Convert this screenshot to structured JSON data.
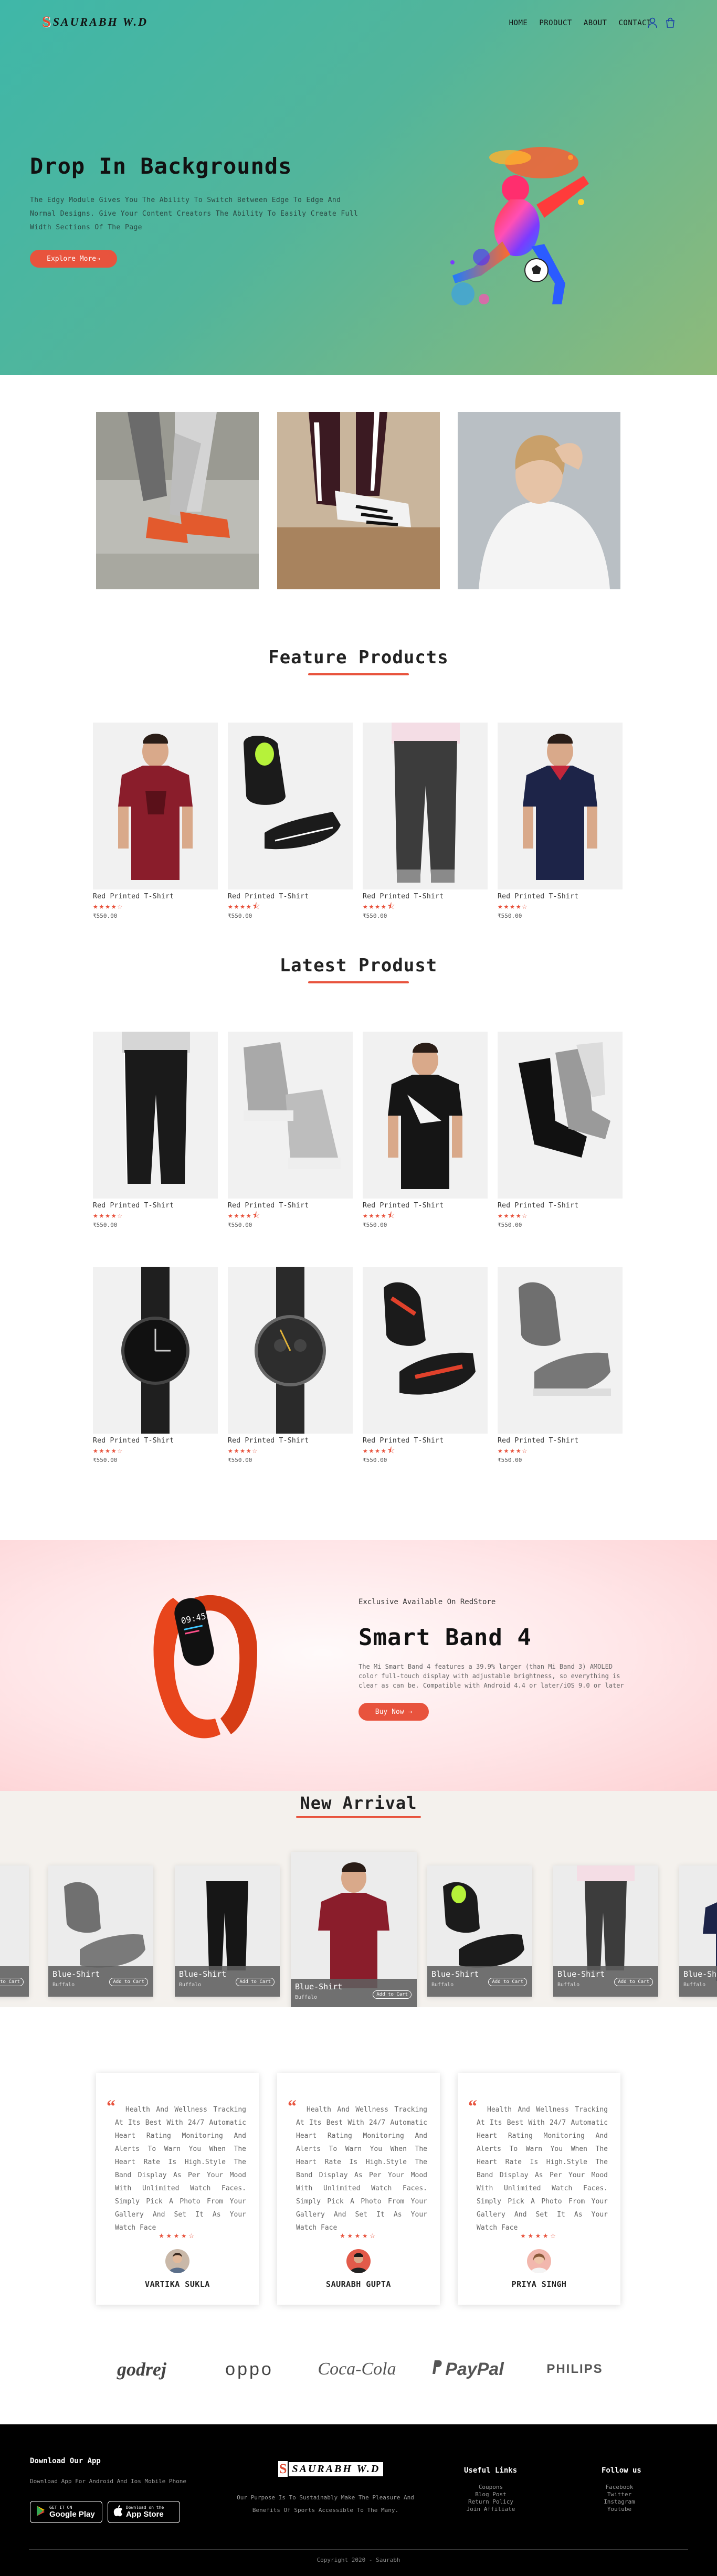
{
  "nav": {
    "logo_letter": "S",
    "logo_text": "SAURABH W.D",
    "links": [
      "HOME",
      "PRODUCT",
      "ABOUT",
      "CONTACT"
    ]
  },
  "hero": {
    "title": "Drop In Backgrounds",
    "description": "The Edgy Module Gives You The Ability To Switch Between Edge To Edge And Normal Designs. Give Your Content Creators The Ability To Easily Create Full Width Sections Of The Page",
    "button": "Explore More→"
  },
  "featured": {
    "title": "Feature Products",
    "products": [
      {
        "name": "Red Printed T-Shirt",
        "stars": "★★★★☆",
        "price": "₹550.00"
      },
      {
        "name": "Red Printed T-Shirt",
        "stars": "★★★★⯪",
        "price": "₹550.00"
      },
      {
        "name": "Red Printed T-Shirt",
        "stars": "★★★★⯪",
        "price": "₹550.00"
      },
      {
        "name": "Red Printed T-Shirt",
        "stars": "★★★★☆",
        "price": "₹550.00"
      }
    ]
  },
  "latest": {
    "title": "Latest Produst",
    "products": [
      {
        "name": "Red Printed T-Shirt",
        "stars": "★★★★☆",
        "price": "₹550.00"
      },
      {
        "name": "Red Printed T-Shirt",
        "stars": "★★★★⯪",
        "price": "₹550.00"
      },
      {
        "name": "Red Printed T-Shirt",
        "stars": "★★★★⯪",
        "price": "₹550.00"
      },
      {
        "name": "Red Printed T-Shirt",
        "stars": "★★★★☆",
        "price": "₹550.00"
      },
      {
        "name": "Red Printed T-Shirt",
        "stars": "★★★★☆",
        "price": "₹550.00"
      },
      {
        "name": "Red Printed T-Shirt",
        "stars": "★★★★☆",
        "price": "₹550.00"
      },
      {
        "name": "Red Printed T-Shirt",
        "stars": "★★★★⯪",
        "price": "₹550.00"
      },
      {
        "name": "Red Printed T-Shirt",
        "stars": "★★★★☆",
        "price": "₹550.00"
      }
    ]
  },
  "band": {
    "kicker": "Exclusive Available On RedStore",
    "title": "Smart Band 4",
    "description": "The Mi Smart Band 4 features a 39.9% larger (than Mi Band 3) AMOLED color full-touch display with adjustable brightness, so everything is clear as can be. Compatible with Android 4.4 or later/iOS 9.0 or later",
    "button": "Buy Now →",
    "watch_time": "09:45"
  },
  "arrival": {
    "title": "New Arrival",
    "card_name": "Blue-Shirt",
    "card_sub": "Buffalo",
    "cart_label": "Add to Cart"
  },
  "testimonials": [
    {
      "text": "Health And Wellness Tracking At Its Best With 24/7 Automatic Heart Rating Monitoring And Alerts To Warn You When The Heart Rate Is High.Style The Band Display As Per Your Mood With Unlimited Watch Faces. Simply Pick A Photo From Your Gallery And Set It As Your Watch Face",
      "stars": "★★★★☆",
      "name": "VARTIKA SUKLA"
    },
    {
      "text": "Health And Wellness Tracking At Its Best With 24/7 Automatic Heart Rating Monitoring And Alerts To Warn You When The Heart Rate Is High.Style The Band Display As Per Your Mood With Unlimited Watch Faces. Simply Pick A Photo From Your Gallery And Set It As Your Watch Face",
      "stars": "★★★★☆",
      "name": "SAURABH GUPTA"
    },
    {
      "text": "Health And Wellness Tracking At Its Best With 24/7 Automatic Heart Rating Monitoring And Alerts To Warn You When The Heart Rate Is High.Style The Band Display As Per Your Mood With Unlimited Watch Faces. Simply Pick A Photo From Your Gallery And Set It As Your Watch Face",
      "stars": "★★★★☆",
      "name": "PRIYA SINGH"
    }
  ],
  "brands": [
    "godrej",
    "oppo",
    "Coca-Cola",
    "PayPal",
    "PHILIPS"
  ],
  "footer": {
    "download_title": "Download Our App",
    "download_text": "Download App For Android And Ios Mobile Phone",
    "google_small": "GET IT ON",
    "google_big": "Google Play",
    "apple_small": "Download on the",
    "apple_big": "App Store",
    "logo_letter": "S",
    "logo_text": "SAURABH W.D",
    "mission": "Our Purpose Is To Sustainably Make The Pleasure And Benefits Of Sports Accessible To The Many.",
    "useful_title": "Useful Links",
    "useful": [
      "Coupons",
      "Blog Post",
      "Return Policy",
      "Join Affiliate"
    ],
    "follow_title": "Follow us",
    "follow": [
      "Facebook",
      "Twitter",
      "Instagram",
      "Youtube"
    ],
    "copyright": "Copyright 2020 - Saurabh"
  },
  "colors": {
    "accent": "#e8533d",
    "hero_start": "#3fb7a8",
    "hero_end": "#8fba7a",
    "footer_bg": "#000000"
  }
}
